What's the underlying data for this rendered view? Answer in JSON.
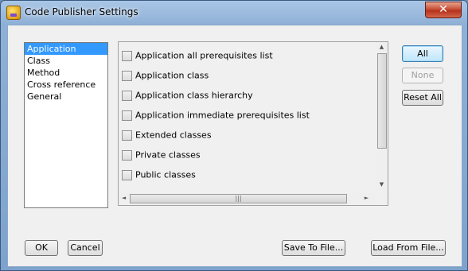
{
  "window": {
    "title": "Code Publisher Settings",
    "close_label": "✕"
  },
  "tree": {
    "items": [
      {
        "label": "Application",
        "selected": true
      },
      {
        "label": "Class",
        "selected": false
      },
      {
        "label": "Method",
        "selected": false
      },
      {
        "label": "Cross reference",
        "selected": false
      },
      {
        "label": "General",
        "selected": false
      }
    ]
  },
  "options": {
    "items": [
      {
        "label": "Application all prerequisites list",
        "checked": false
      },
      {
        "label": "Application class",
        "checked": false
      },
      {
        "label": "Application class hierarchy",
        "checked": false
      },
      {
        "label": "Application immediate prerequisites list",
        "checked": false
      },
      {
        "label": "Extended classes",
        "checked": false
      },
      {
        "label": "Private classes",
        "checked": false
      },
      {
        "label": "Public classes",
        "checked": false
      }
    ]
  },
  "scroll": {
    "up": "▲",
    "down": "▼",
    "left": "◄",
    "right": "►",
    "grip": "|||"
  },
  "side_buttons": {
    "all": "All",
    "none": "None",
    "reset_all": "Reset All"
  },
  "bottom_buttons": {
    "ok": "OK",
    "cancel": "Cancel",
    "save": "Save To File...",
    "load": "Load From File..."
  }
}
